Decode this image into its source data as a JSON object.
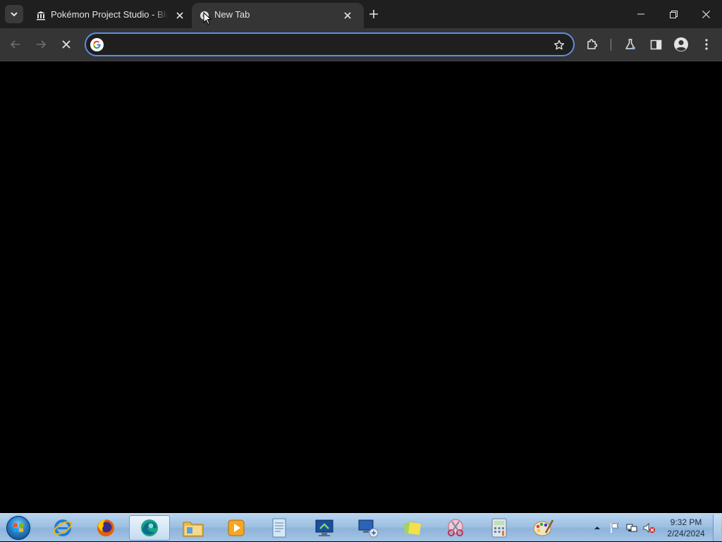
{
  "browser": {
    "tabs": [
      {
        "title": "Pokémon Project Studio - Blue",
        "active": false,
        "favicon": "museum-icon"
      },
      {
        "title": "New Tab",
        "active": true,
        "favicon": "loading-spinner-icon"
      }
    ],
    "omnibox": {
      "value": "",
      "placeholder": ""
    },
    "colors": {
      "tabstrip": "#1f1f1f",
      "toolbar": "#353535",
      "focus_ring": "#5a8fe6",
      "content": "#000000"
    }
  },
  "taskbar": {
    "apps": [
      "internet-explorer",
      "firefox",
      "chrome-edge",
      "file-explorer",
      "media-player",
      "document-viewer",
      "remote-desktop",
      "network-manager",
      "sticky-notes",
      "snipping-tool",
      "calculator",
      "paint"
    ],
    "clock": {
      "time": "9:32 PM",
      "date": "2/24/2024"
    }
  }
}
